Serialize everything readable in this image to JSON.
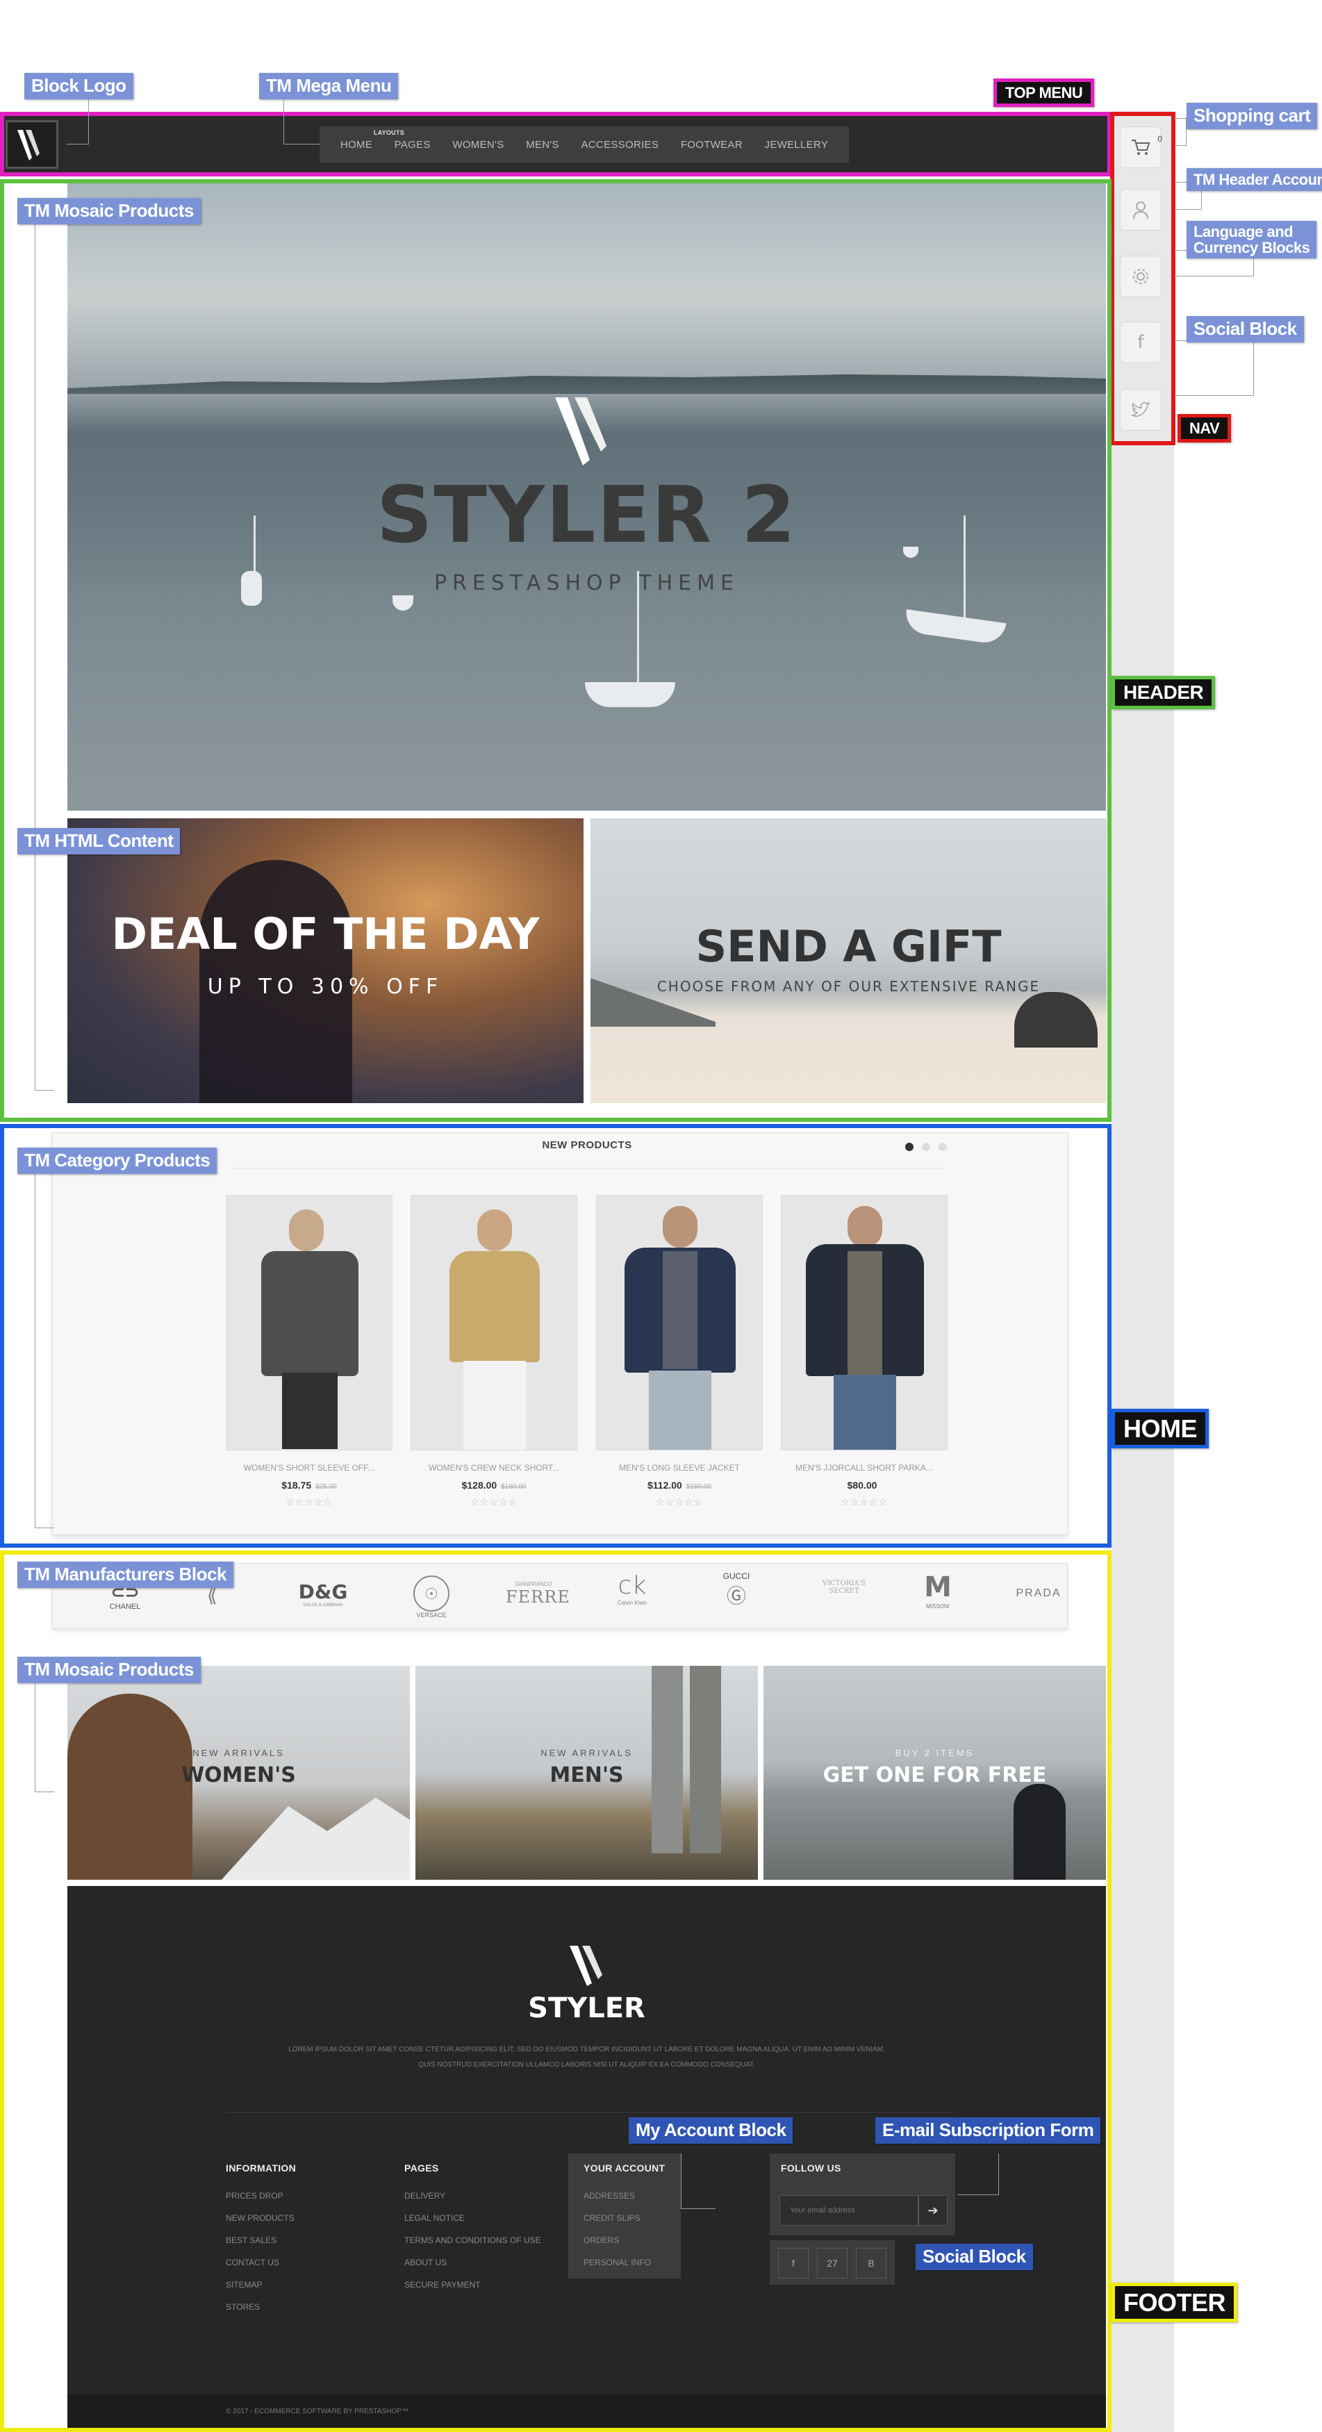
{
  "labels": {
    "block_logo": "Block Logo",
    "mega_menu": "TM Mega Menu",
    "top_menu": "TOP MENU",
    "shopping_cart": "Shopping cart",
    "header_account": "TM Header Account",
    "language_currency_1": "Language and",
    "language_currency_2": "Currency Blocks",
    "social_block": "Social Block",
    "nav": "NAV",
    "header": "HEADER",
    "mosaic_products": "TM Mosaic Products",
    "html_content": "TM HTML Content",
    "category_products": "TM Category Products",
    "home": "HOME",
    "manufacturers_block": "TM Manufacturers Block",
    "mosaic_products_2": "TM Mosaic Products",
    "my_account_block": "My Account Block",
    "email_subscription": "E-mail Subscription Form",
    "social_block_footer": "Social Block",
    "footer": "FOOTER"
  },
  "colors": {
    "top_menu": "#e020c0",
    "nav": "#e01818",
    "header": "#5cc040",
    "home": "#1a5fe0",
    "footer": "#f0ec10"
  },
  "menu": {
    "super": "LAYOUTS",
    "items": [
      "HOME",
      "PAGES",
      "WOMEN'S",
      "MEN'S",
      "ACCESSORIES",
      "FOOTWEAR",
      "JEWELLERY"
    ]
  },
  "nav": {
    "cart_count": "0",
    "icons": [
      "cart-icon",
      "user-icon",
      "gear-icon",
      "facebook-icon",
      "twitter-icon"
    ]
  },
  "hero": {
    "title": "STYLER 2",
    "subtitle": "PRESTASHOP THEME"
  },
  "banners": {
    "deal_title": "DEAL OF THE DAY",
    "deal_sub": "UP TO 30% OFF",
    "gift_title": "SEND A GIFT",
    "gift_sub": "CHOOSE FROM ANY OF OUR EXTENSIVE RANGE"
  },
  "category": {
    "title": "NEW PRODUCTS",
    "products": [
      {
        "name": "WOMEN'S SHORT SLEEVE OFF...",
        "price": "$18.75",
        "old_price": "$25.00",
        "stars": "☆☆☆☆☆"
      },
      {
        "name": "WOMEN'S CREW NECK SHORT...",
        "price": "$128.00",
        "old_price": "$160.00",
        "stars": "☆☆☆☆☆"
      },
      {
        "name": "MEN'S LONG SLEEVE JACKET",
        "price": "$112.00",
        "old_price": "$160.00",
        "stars": "☆☆☆☆☆"
      },
      {
        "name": "MEN'S JJORCALL SHORT PARKA...",
        "price": "$80.00",
        "old_price": "",
        "stars": "☆☆☆☆☆"
      }
    ]
  },
  "brands": [
    "CHANEL",
    "D&G",
    "VERSACE",
    "FERRE",
    "CK",
    "GUCCI",
    "VICTORIA'S SECRET",
    "MISSONI",
    "PRADA"
  ],
  "brand_details": {
    "dg_sub": "DOLCE & GABBANA",
    "ferre_top": "GIANFRANCO",
    "ck_sub": "Calvin Klein",
    "victoria_2": "SECRET"
  },
  "mosaic": [
    {
      "sub": "NEW ARRIVALS",
      "title": "WOMEN'S"
    },
    {
      "sub": "NEW ARRIVALS",
      "title": "MEN'S"
    },
    {
      "sub": "BUY 2 ITEMS",
      "title": "GET ONE FOR FREE"
    }
  ],
  "footer": {
    "brand": "STYLER",
    "text_1": "LOREM IPSUM DOLOR SIT AMET CONSE CTETUR ADIPISICING ELIT, SED DO EIUSMOD TEMPOR INCIDIDUNT UT LABORE ET DOLORE MAGNA ALIQUA. UT ENIM AD MINIM VENIAM,",
    "text_2": "QUIS NOSTRUD EXERCITATION ULLAMCO LABORIS NISI UT ALIQUIP EX EA COMMODO CONSEQUAT.",
    "information": {
      "title": "INFORMATION",
      "links": [
        "PRICES DROP",
        "NEW PRODUCTS",
        "BEST SALES",
        "CONTACT US",
        "SITEMAP",
        "STORES"
      ]
    },
    "pages": {
      "title": "PAGES",
      "links": [
        "DELIVERY",
        "LEGAL NOTICE",
        "TERMS AND CONDITIONS OF USE",
        "ABOUT US",
        "SECURE PAYMENT"
      ]
    },
    "account": {
      "title": "YOUR ACCOUNT",
      "links": [
        "ADDRESSES",
        "CREDIT SLIPS",
        "ORDERS",
        "PERSONAL INFO"
      ]
    },
    "follow": {
      "title": "FOLLOW US",
      "placeholder": "Your email address"
    },
    "social": [
      "f",
      "27",
      "B"
    ],
    "copyright": "© 2017 - ECOMMERCE SOFTWARE BY PRESTASHOP™"
  }
}
